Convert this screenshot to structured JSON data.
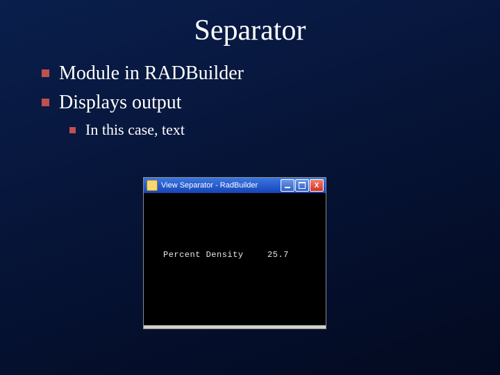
{
  "title": "Separator",
  "bullets": {
    "b1": "Module in RADBuilder",
    "b2": "Displays output",
    "b2_1": "In this case, text"
  },
  "window": {
    "title": "View Separator - RadBuilder",
    "output_label": "Percent Density",
    "output_value": "25.7",
    "close_glyph": "X"
  }
}
